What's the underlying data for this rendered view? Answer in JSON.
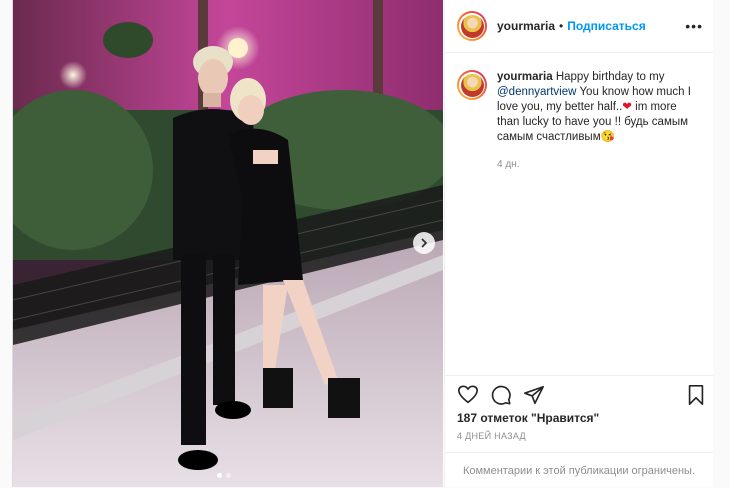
{
  "post": {
    "username": "yourmaria",
    "follow_label": "Подписаться",
    "separator": "•",
    "more_label": "•••",
    "caption": {
      "username": "yourmaria",
      "text_intro": "Happy birthday to my",
      "mention": "@dennyartview",
      "text_body": "You know how much I love you, my better half..",
      "heart": "❤",
      "text_after": "im more than lucky to have you !! будь самым самым счастливым",
      "emoji": "😘",
      "time": "4 дн."
    },
    "likes": "187 отметок \"Нравится\"",
    "date": "4 ДНЕЙ НАЗАД",
    "comments_disabled": "Комментарии к этой публикации ограничены."
  },
  "carousel": {
    "pages": 2,
    "current": 1
  },
  "icons": [
    "heart-icon",
    "comment-icon",
    "share-icon",
    "bookmark-icon",
    "chevron-right-icon",
    "more-icon"
  ],
  "colors": {
    "link": "#0095f6",
    "mention": "#00376b",
    "heart": "#e0102a",
    "muted": "#8e8e8e",
    "text": "#262626"
  }
}
